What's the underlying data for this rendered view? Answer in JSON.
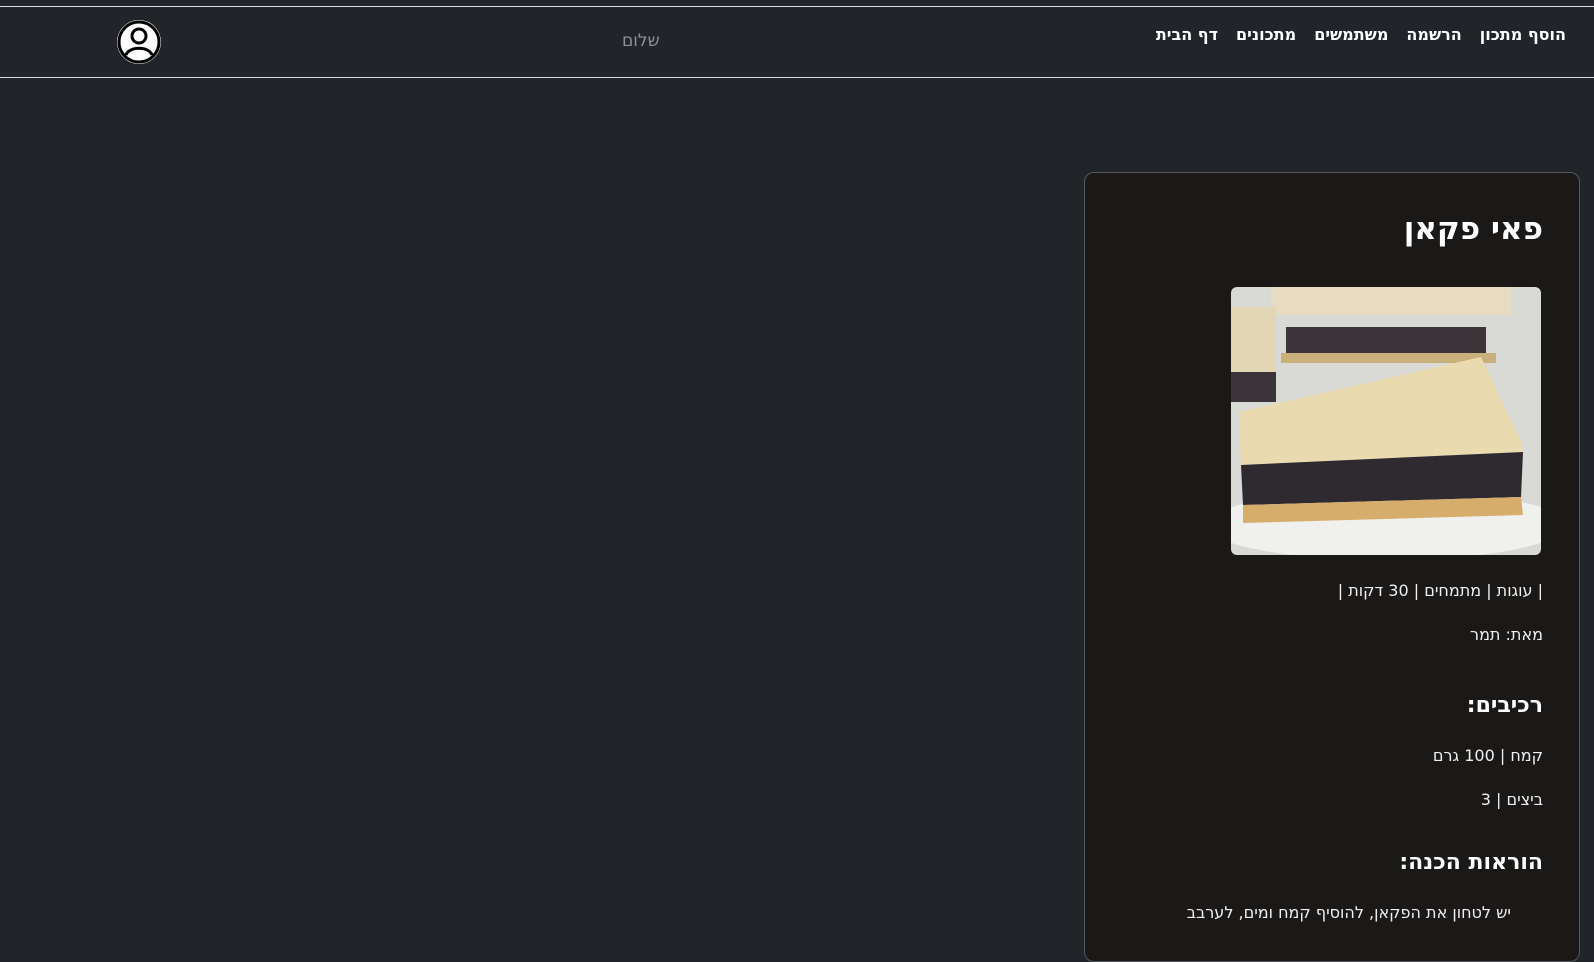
{
  "nav": {
    "items": [
      {
        "label": "דף הבית"
      },
      {
        "label": "מתכונים"
      },
      {
        "label": "משתמשים"
      },
      {
        "label": "הרשמה"
      },
      {
        "label": "הוסף מתכון"
      }
    ],
    "greeting": "שלום"
  },
  "recipe": {
    "title": "פאי פקאן",
    "meta_line": "| עוגות | מתמחים | 30 דקות |",
    "author_line": "מאת: תמר",
    "ingredients_heading": "רכיבים:",
    "ingredients": [
      "קמח | 100 גרם",
      "ביצים | 3"
    ],
    "instructions_heading": "הוראות הכנה:",
    "instructions_first_line": "יש לטחון את הפקאן, להוסיף קמח ומים, לערבב"
  },
  "colors": {
    "page_bg": "#212529",
    "card_bg": "#1b1918",
    "greeting": "#8f9296"
  },
  "icons": {
    "avatar": "user-circle-icon"
  }
}
